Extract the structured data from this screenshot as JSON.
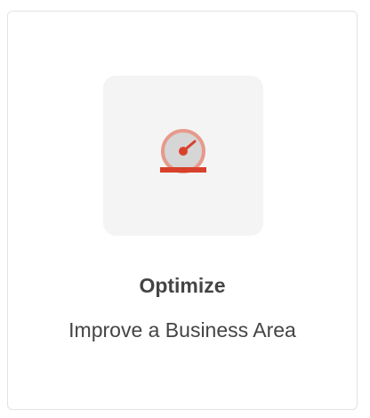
{
  "card": {
    "title": "Optimize",
    "subtitle": "Improve a Business Area",
    "icon": "speedometer-icon"
  },
  "colors": {
    "icon_accent": "#d9402b",
    "icon_ring": "#e69a8c",
    "icon_face": "#d6d6d6",
    "tile_background": "#f4f4f4",
    "text": "#444444",
    "border": "#e3e3e3"
  }
}
